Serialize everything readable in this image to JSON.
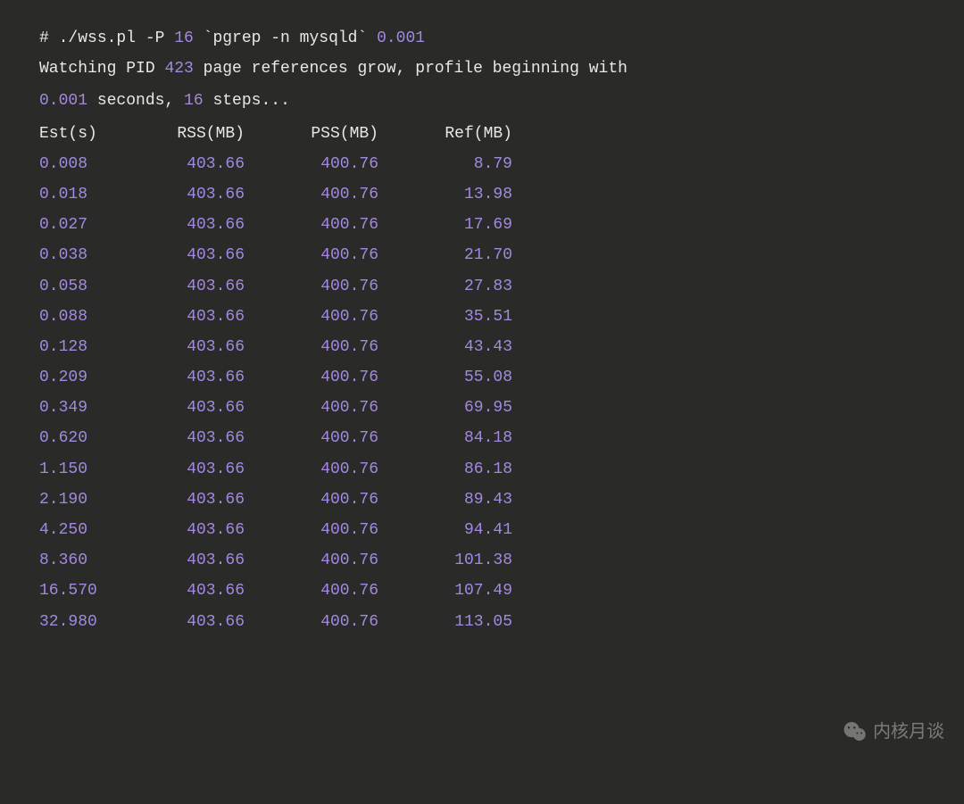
{
  "command": {
    "prompt": "# ",
    "cmd_part1": "./wss.pl -P ",
    "arg1": "16",
    "cmd_part2": " `pgrep -n mysqld` ",
    "arg2": "0.001"
  },
  "info": {
    "pre_pid": "Watching PID ",
    "pid": "423",
    "mid1": " page references grow, profile beginning with ",
    "seconds": "0.001",
    "mid2": " seconds, ",
    "steps": "16",
    "tail": " steps..."
  },
  "headers": {
    "c1": "Est(s)",
    "c2": "RSS(MB)",
    "c3": "PSS(MB)",
    "c4": "Ref(MB)"
  },
  "rows": [
    {
      "est": "0.008",
      "rss": "403.66",
      "pss": "400.76",
      "ref": "8.79"
    },
    {
      "est": "0.018",
      "rss": "403.66",
      "pss": "400.76",
      "ref": "13.98"
    },
    {
      "est": "0.027",
      "rss": "403.66",
      "pss": "400.76",
      "ref": "17.69"
    },
    {
      "est": "0.038",
      "rss": "403.66",
      "pss": "400.76",
      "ref": "21.70"
    },
    {
      "est": "0.058",
      "rss": "403.66",
      "pss": "400.76",
      "ref": "27.83"
    },
    {
      "est": "0.088",
      "rss": "403.66",
      "pss": "400.76",
      "ref": "35.51"
    },
    {
      "est": "0.128",
      "rss": "403.66",
      "pss": "400.76",
      "ref": "43.43"
    },
    {
      "est": "0.209",
      "rss": "403.66",
      "pss": "400.76",
      "ref": "55.08"
    },
    {
      "est": "0.349",
      "rss": "403.66",
      "pss": "400.76",
      "ref": "69.95"
    },
    {
      "est": "0.620",
      "rss": "403.66",
      "pss": "400.76",
      "ref": "84.18"
    },
    {
      "est": "1.150",
      "rss": "403.66",
      "pss": "400.76",
      "ref": "86.18"
    },
    {
      "est": "2.190",
      "rss": "403.66",
      "pss": "400.76",
      "ref": "89.43"
    },
    {
      "est": "4.250",
      "rss": "403.66",
      "pss": "400.76",
      "ref": "94.41"
    },
    {
      "est": "8.360",
      "rss": "403.66",
      "pss": "400.76",
      "ref": "101.38"
    },
    {
      "est": "16.570",
      "rss": "403.66",
      "pss": "400.76",
      "ref": "107.49"
    },
    {
      "est": "32.980",
      "rss": "403.66",
      "pss": "400.76",
      "ref": "113.05"
    }
  ],
  "watermark": {
    "text": "内核月谈"
  }
}
